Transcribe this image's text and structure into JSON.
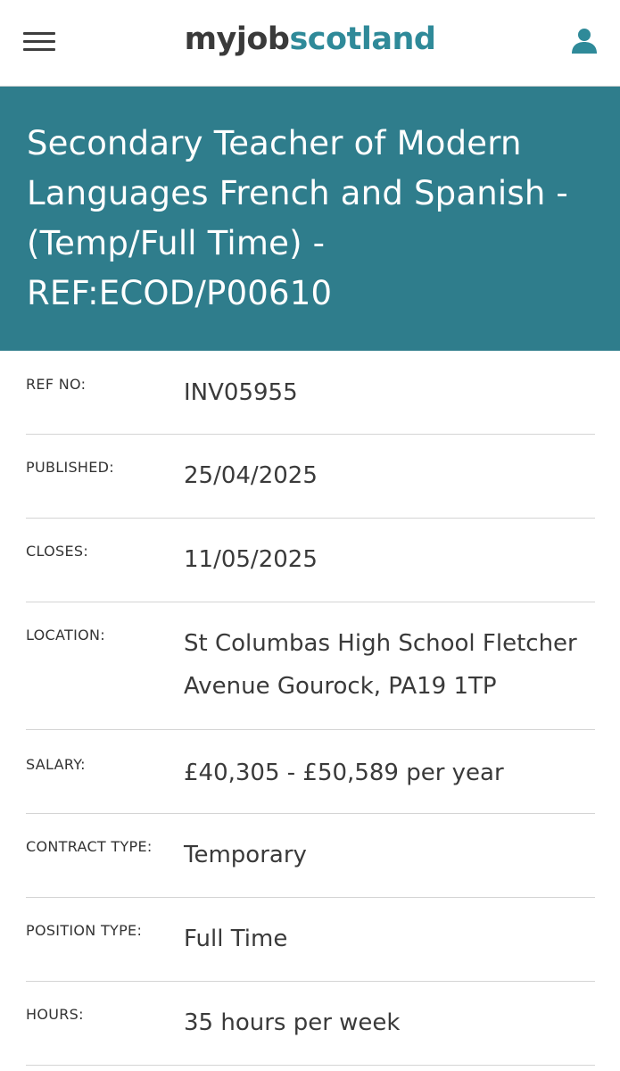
{
  "header": {
    "logo_my": "myjob",
    "logo_scotland": "scotland",
    "menu_icon": "hamburger-menu-icon",
    "account_icon": "user-account-icon",
    "brand_color": "#2f8a99"
  },
  "banner": {
    "title": "Secondary Teacher of Modern Languages French and Spanish - (Temp/Full Time) - REF:ECOD/P00610",
    "background_color": "#2f7d8c"
  },
  "details": {
    "ref_no": {
      "label": "REF NO:",
      "value": "INV05955"
    },
    "published": {
      "label": "PUBLISHED:",
      "value": "25/04/2025"
    },
    "closes": {
      "label": "CLOSES:",
      "value": "11/05/2025"
    },
    "location": {
      "label": "LOCATION:",
      "value": "St Columbas High School Fletcher Avenue Gourock, PA19 1TP"
    },
    "salary": {
      "label": "SALARY:",
      "value": "£40,305 - £50,589 per year"
    },
    "contract_type": {
      "label": "CONTRACT TYPE:",
      "value": "Temporary"
    },
    "position_type": {
      "label": "POSITION TYPE:",
      "value": "Full Time"
    },
    "hours": {
      "label": "HOURS:",
      "value": "35 hours per week"
    }
  }
}
